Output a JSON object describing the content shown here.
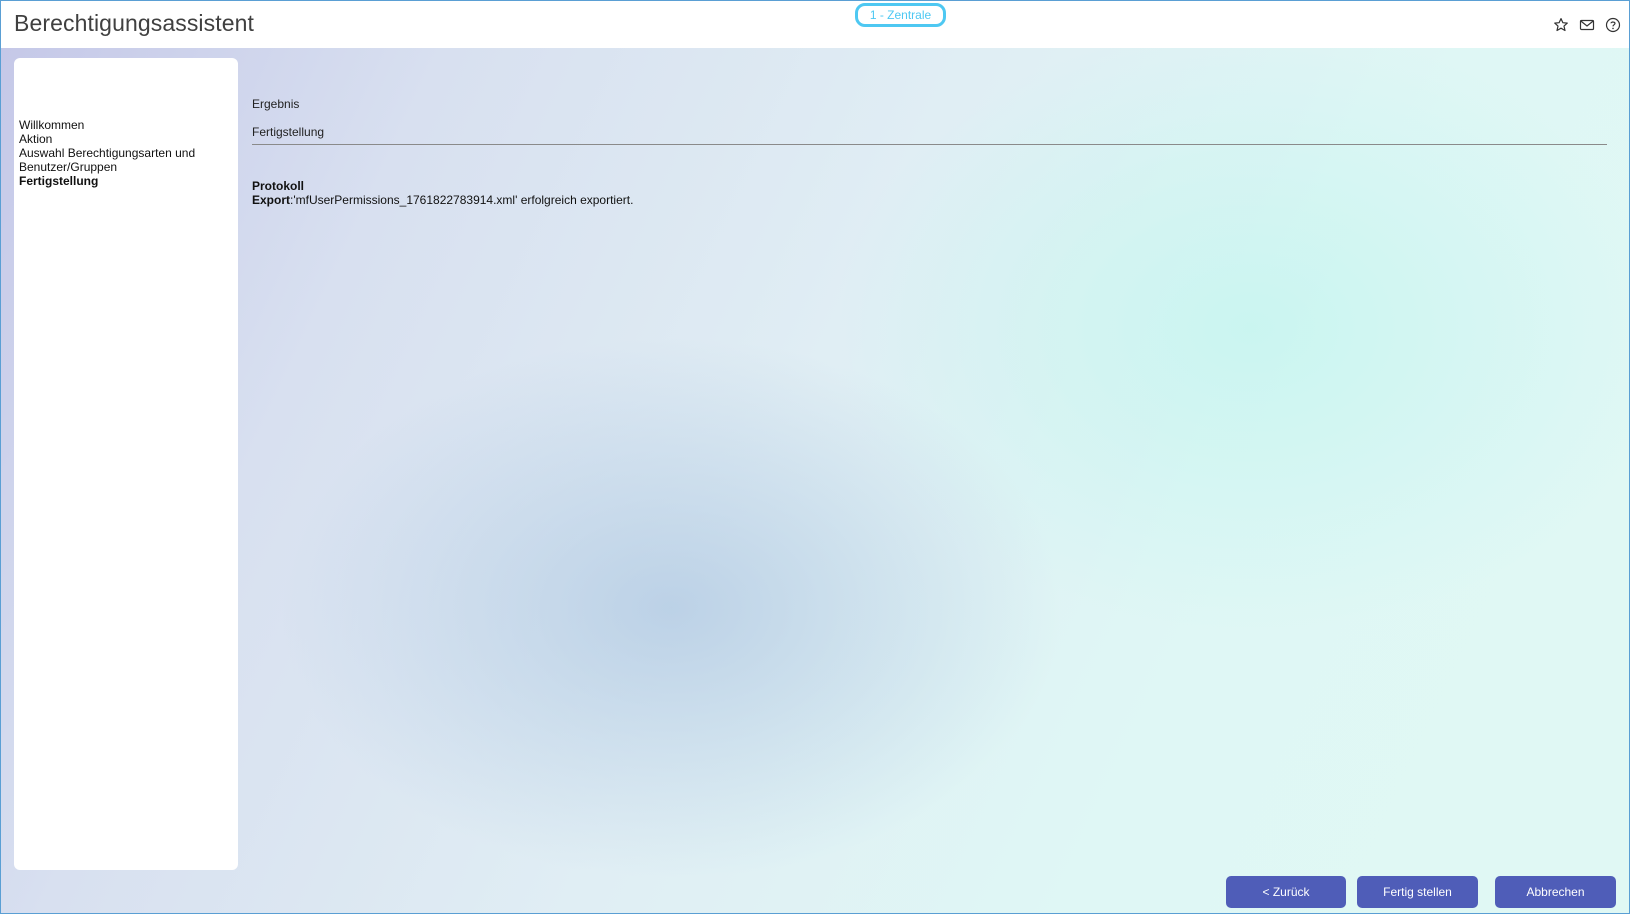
{
  "window": {
    "title": "Berechtigungsassistent",
    "branch": "1 - Zentrale",
    "icons": [
      "star-icon",
      "mail-icon",
      "help-icon"
    ]
  },
  "sidebar": {
    "steps": [
      {
        "label": "Willkommen",
        "active": false
      },
      {
        "label": "Aktion",
        "active": false
      },
      {
        "label": "Auswahl Berechtigungsarten und Benutzer/Gruppen",
        "active": false
      },
      {
        "label": "Fertigstellung",
        "active": true
      }
    ]
  },
  "main": {
    "heading": "Ergebnis",
    "subheading": "Fertigstellung",
    "log_title": "Protokoll",
    "log_entries": [
      {
        "label": "Export",
        "text": ":'mfUserPermissions_1761822783914.xml' erfolgreich exportiert."
      }
    ]
  },
  "buttons": {
    "back": "< Zurück",
    "finish": "Fertig stellen",
    "cancel": "Abbrechen"
  },
  "colors": {
    "accent": "#4f5db8",
    "badge": "#4ec8f2"
  }
}
